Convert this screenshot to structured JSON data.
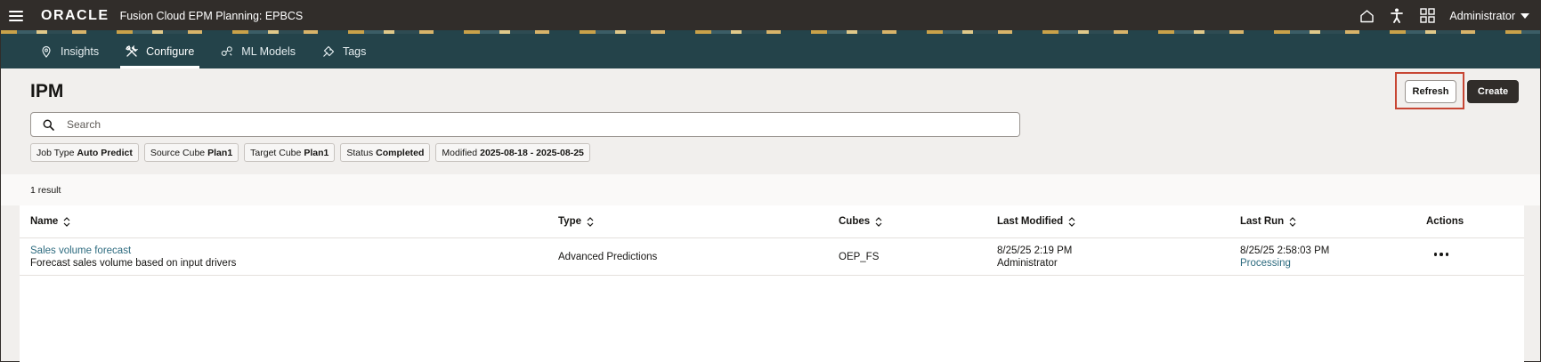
{
  "topbar": {
    "logo": "ORACLE",
    "app_title": "Fusion Cloud EPM Planning:  EPBCS",
    "user": "Administrator",
    "icons": [
      "hamburger-icon",
      "home-icon",
      "accessibility-icon",
      "apps-grid-icon",
      "chevron-down-icon"
    ]
  },
  "nav": {
    "tabs": [
      {
        "label": "Insights",
        "icon": "location-pin-icon",
        "active": false
      },
      {
        "label": "Configure",
        "icon": "tools-icon",
        "active": true
      },
      {
        "label": "ML Models",
        "icon": "ml-model-icon",
        "active": false
      },
      {
        "label": "Tags",
        "icon": "tag-icon",
        "active": false
      }
    ]
  },
  "page": {
    "title": "IPM",
    "refresh_label": "Refresh",
    "create_label": "Create"
  },
  "search": {
    "placeholder": "Search",
    "value": ""
  },
  "filters": [
    {
      "label": "Job Type",
      "value": "Auto Predict"
    },
    {
      "label": "Source Cube",
      "value": "Plan1"
    },
    {
      "label": "Target Cube",
      "value": "Plan1"
    },
    {
      "label": "Status",
      "value": "Completed"
    },
    {
      "label": "Modified",
      "value": "2025-08-18 - 2025-08-25"
    }
  ],
  "results": {
    "count_label": "1 result"
  },
  "table": {
    "columns": [
      "Name",
      "Type",
      "Cubes",
      "Last Modified",
      "Last Run",
      "Actions"
    ],
    "rows": [
      {
        "name": "Sales volume forecast",
        "description": "Forecast sales volume based on input drivers",
        "type": "Advanced Predictions",
        "cubes": "OEP_FS",
        "last_modified_date": "8/25/25 2:19 PM",
        "last_modified_by": "Administrator",
        "last_run_date": "8/25/25 2:58:03 PM",
        "last_run_status": "Processing"
      }
    ]
  },
  "colors": {
    "topbar": "#312d2a",
    "navbar": "#24434a",
    "link": "#2d6b7f",
    "highlight": "#c74634",
    "background": "#f1efed"
  }
}
